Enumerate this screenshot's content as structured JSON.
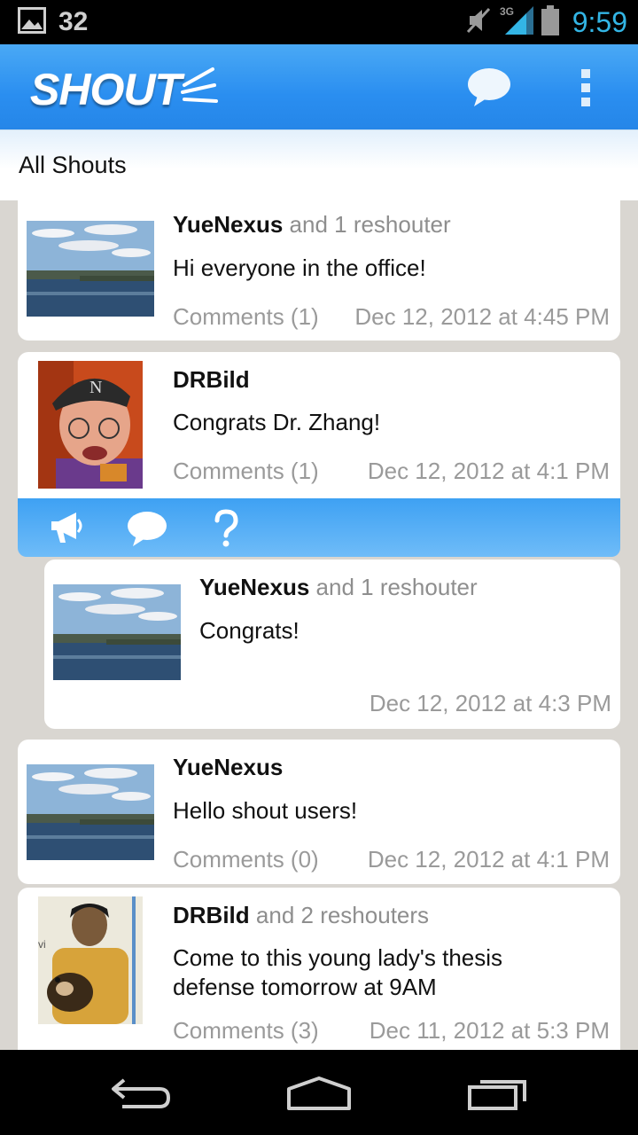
{
  "status_bar": {
    "notification_icon": "image-icon",
    "notification_count": "32",
    "network": "3G",
    "time": "9:59"
  },
  "action_bar": {
    "logo_text": "SHOUT",
    "compose_icon": "chat-bubble-icon",
    "overflow_icon": "overflow-menu-icon"
  },
  "filter": {
    "label": "All Shouts"
  },
  "shouts": [
    {
      "user": "YueNexus",
      "reshouters": "and 1 reshouter",
      "message": "Hi everyone in the office!",
      "comments": "Comments (1)",
      "date": "Dec 12, 2012 at 4:45 PM"
    },
    {
      "user": "DRBild",
      "reshouters": "",
      "message": "Congrats Dr. Zhang!",
      "comments": "Comments (1)",
      "date": "Dec 12, 2012 at 4:1 PM"
    },
    {
      "user": "YueNexus",
      "reshouters": "and 1 reshouter",
      "message": "Congrats!",
      "comments": "",
      "date": "Dec 12, 2012 at 4:3 PM"
    },
    {
      "user": "YueNexus",
      "reshouters": "",
      "message": "Hello shout users!",
      "comments": "Comments (0)",
      "date": "Dec 12, 2012 at 4:1 PM"
    },
    {
      "user": "DRBild",
      "reshouters": "and 2 reshouters",
      "message": "Come to this young lady's thesis defense tomorrow at 9AM",
      "comments": "Comments (3)",
      "date": "Dec 11, 2012 at 5:3 PM"
    }
  ],
  "shout_actions": [
    "reshout-megaphone-icon",
    "comment-bubble-icon",
    "question-icon"
  ],
  "nav_bar": [
    "back-icon",
    "home-icon",
    "recent-apps-icon"
  ],
  "colors": {
    "accent": "#2a8ef0",
    "status_time": "#33b5e5",
    "background": "#d9d6d1"
  }
}
